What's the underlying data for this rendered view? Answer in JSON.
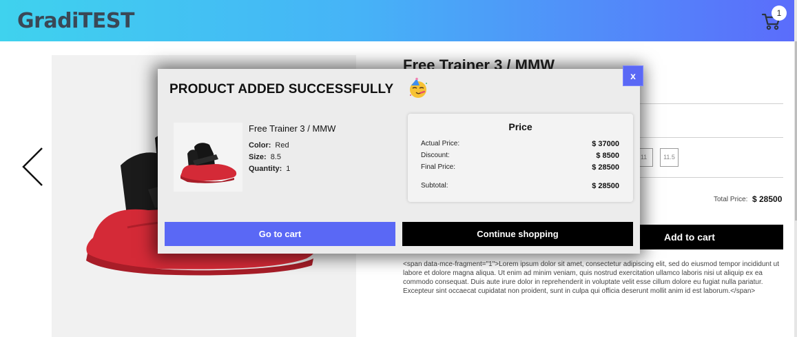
{
  "header": {
    "brand": "GradiTEST",
    "cart_count": "1"
  },
  "product": {
    "title": "Free Trainer 3 / MMW",
    "sizes": [
      "11",
      "11.5"
    ],
    "total_label": "Total Price:",
    "total_value": "$ 28500",
    "add_to_cart_label": "Add to cart",
    "description": "<span data-mce-fragment=\"1\">Lorem ipsum dolor sit amet, consectetur adipiscing elit, sed do eiusmod tempor incididunt ut labore et dolore magna aliqua. Ut enim ad minim veniam, quis nostrud exercitation ullamco laboris nisi ut aliquip ex ea commodo consequat. Duis aute irure dolor in reprehenderit in voluptate velit esse cillum dolore eu fugiat nulla pariatur. Excepteur sint occaecat cupidatat non proident, sunt in culpa qui officia deserunt mollit anim id est laborum.</span>"
  },
  "modal": {
    "title": "PRODUCT ADDED SUCCESSFULLY",
    "close_label": "x",
    "item": {
      "name": "Free Trainer 3 / MMW",
      "color_label": "Color:",
      "color_value": "Red",
      "size_label": "Size:",
      "size_value": "8.5",
      "quantity_label": "Quantity:",
      "quantity_value": "1"
    },
    "price": {
      "heading": "Price",
      "actual_label": "Actual Price:",
      "actual_value": "$ 37000",
      "discount_label": "Discount:",
      "discount_value": "$ 8500",
      "final_label": "Final Price:",
      "final_value": "$ 28500",
      "subtotal_label": "Subtotal:",
      "subtotal_value": "$ 28500"
    },
    "go_to_cart_label": "Go to cart",
    "continue_label": "Continue shopping"
  },
  "colors": {
    "accent": "#5a68f5",
    "header_start": "#3fd2ee",
    "header_end": "#5b6cfb"
  }
}
